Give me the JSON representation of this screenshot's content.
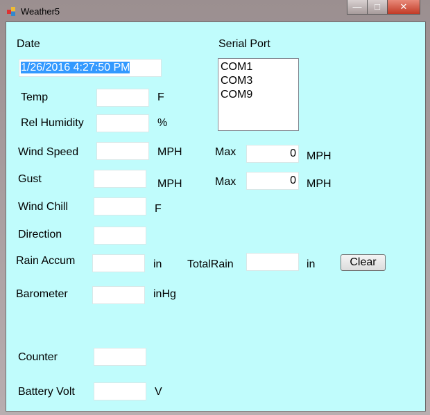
{
  "window": {
    "title": "Weather5",
    "minimize": "—",
    "maximize": "□",
    "close": "✕"
  },
  "date": {
    "label": "Date",
    "value": "1/26/2016 4:27:50 PM"
  },
  "serial": {
    "label": "Serial Port",
    "ports": [
      "COM1",
      "COM3",
      "COM9"
    ]
  },
  "temp": {
    "label": "Temp",
    "unit": "F",
    "value": ""
  },
  "humidity": {
    "label": "Rel Humidity",
    "unit": "%",
    "value": ""
  },
  "wind_speed": {
    "label": "Wind Speed",
    "unit": "MPH",
    "value": "",
    "max_label": "Max",
    "max_value": "0",
    "max_unit": "MPH"
  },
  "gust": {
    "label": "Gust",
    "unit": "MPH",
    "value": "",
    "max_label": "Max",
    "max_value": "0",
    "max_unit": "MPH"
  },
  "wind_chill": {
    "label": "Wind Chill",
    "unit": "F",
    "value": ""
  },
  "direction": {
    "label": "Direction",
    "value": ""
  },
  "rain": {
    "label": "Rain Accum",
    "unit": "in",
    "value": "",
    "total_label": "TotalRain",
    "total_value": "",
    "total_unit": "in",
    "clear": "Clear"
  },
  "barometer": {
    "label": "Barometer",
    "unit": "inHg",
    "value": ""
  },
  "counter": {
    "label": "Counter",
    "value": ""
  },
  "battery": {
    "label": "Battery Volt",
    "unit": "V",
    "value": ""
  }
}
